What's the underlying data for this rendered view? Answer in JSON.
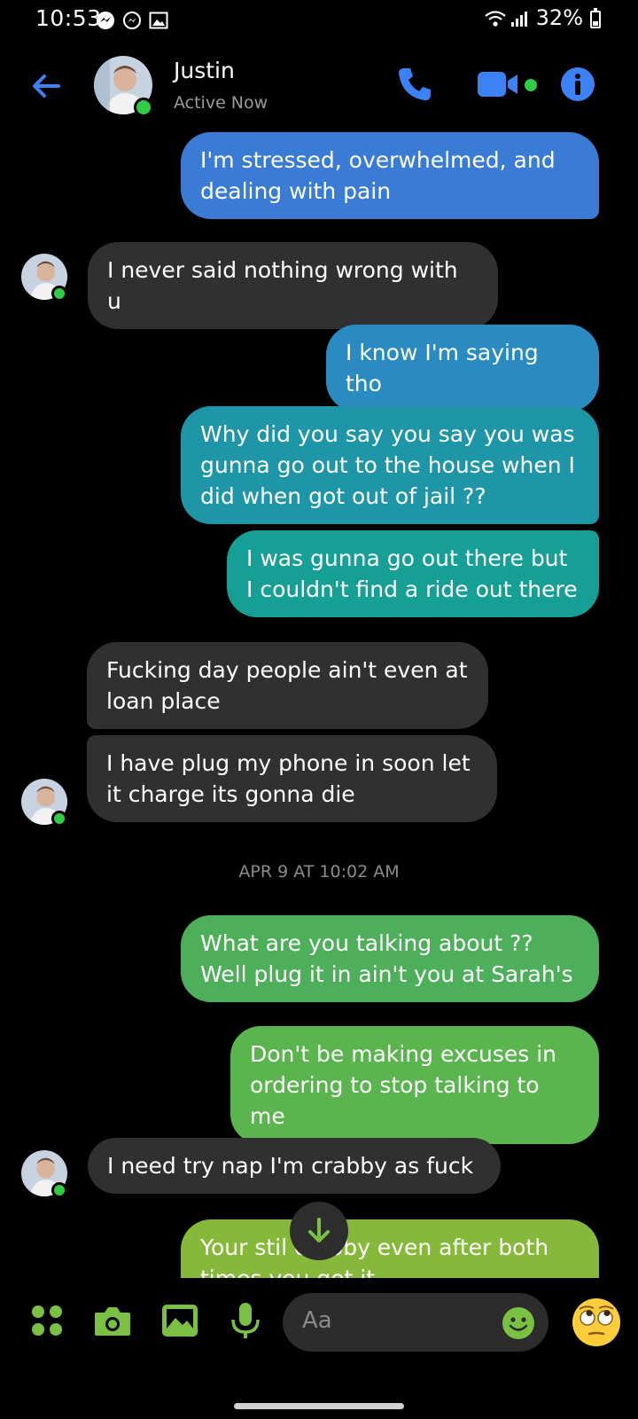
{
  "status_bar": {
    "time": "10:53",
    "battery": "32%"
  },
  "header": {
    "contact_name": "Justin",
    "contact_status": "Active Now"
  },
  "messages": [
    {
      "from": "me",
      "text": "I'm stressed, overwhelmed, and dealing with pain",
      "color": "#3a7bd5"
    },
    {
      "from": "them",
      "text": "I never said nothing  wrong with u"
    },
    {
      "from": "me",
      "text": "I know I'm saying tho",
      "color": "#2a8bc1"
    },
    {
      "from": "me",
      "text": "Why did you say you say you was gunna go out to the house when I did when got out of jail ??",
      "color": "#1f96a8"
    },
    {
      "from": "me",
      "text": "I was gunna go out there but I couldn't find a ride out there",
      "color": "#16a095"
    },
    {
      "from": "them",
      "text": "Fucking day people  ain't even at loan place"
    },
    {
      "from": "them",
      "text": "I have plug my phone in soon let it charge its gonna die"
    },
    {
      "from": "me",
      "text": "What are you talking about ?? Well plug it in ain't you at Sarah's",
      "color": "#4daf5a"
    },
    {
      "from": "me",
      "text": "Don't be making excuses in ordering to stop talking to me",
      "color": "#5ab54e"
    },
    {
      "from": "them",
      "text": "I need try nap I'm crabby as fuck"
    },
    {
      "from": "me",
      "text": "Your stil crabby even after both times you got it",
      "color": "#86b83a"
    }
  ],
  "timestamp": "APR 9 AT 10:02 AM",
  "composer": {
    "placeholder": "Aa"
  },
  "colors": {
    "accent": "#3b82f6",
    "online": "#31cc46",
    "composer_icon": "#7ac143"
  },
  "icons": [
    "back-arrow-icon",
    "phone-icon",
    "video-camera-icon",
    "info-icon",
    "apps-icon",
    "camera-icon",
    "gallery-icon",
    "microphone-icon",
    "emoji-icon",
    "eye-roll-emoji-icon",
    "arrow-down-icon"
  ]
}
